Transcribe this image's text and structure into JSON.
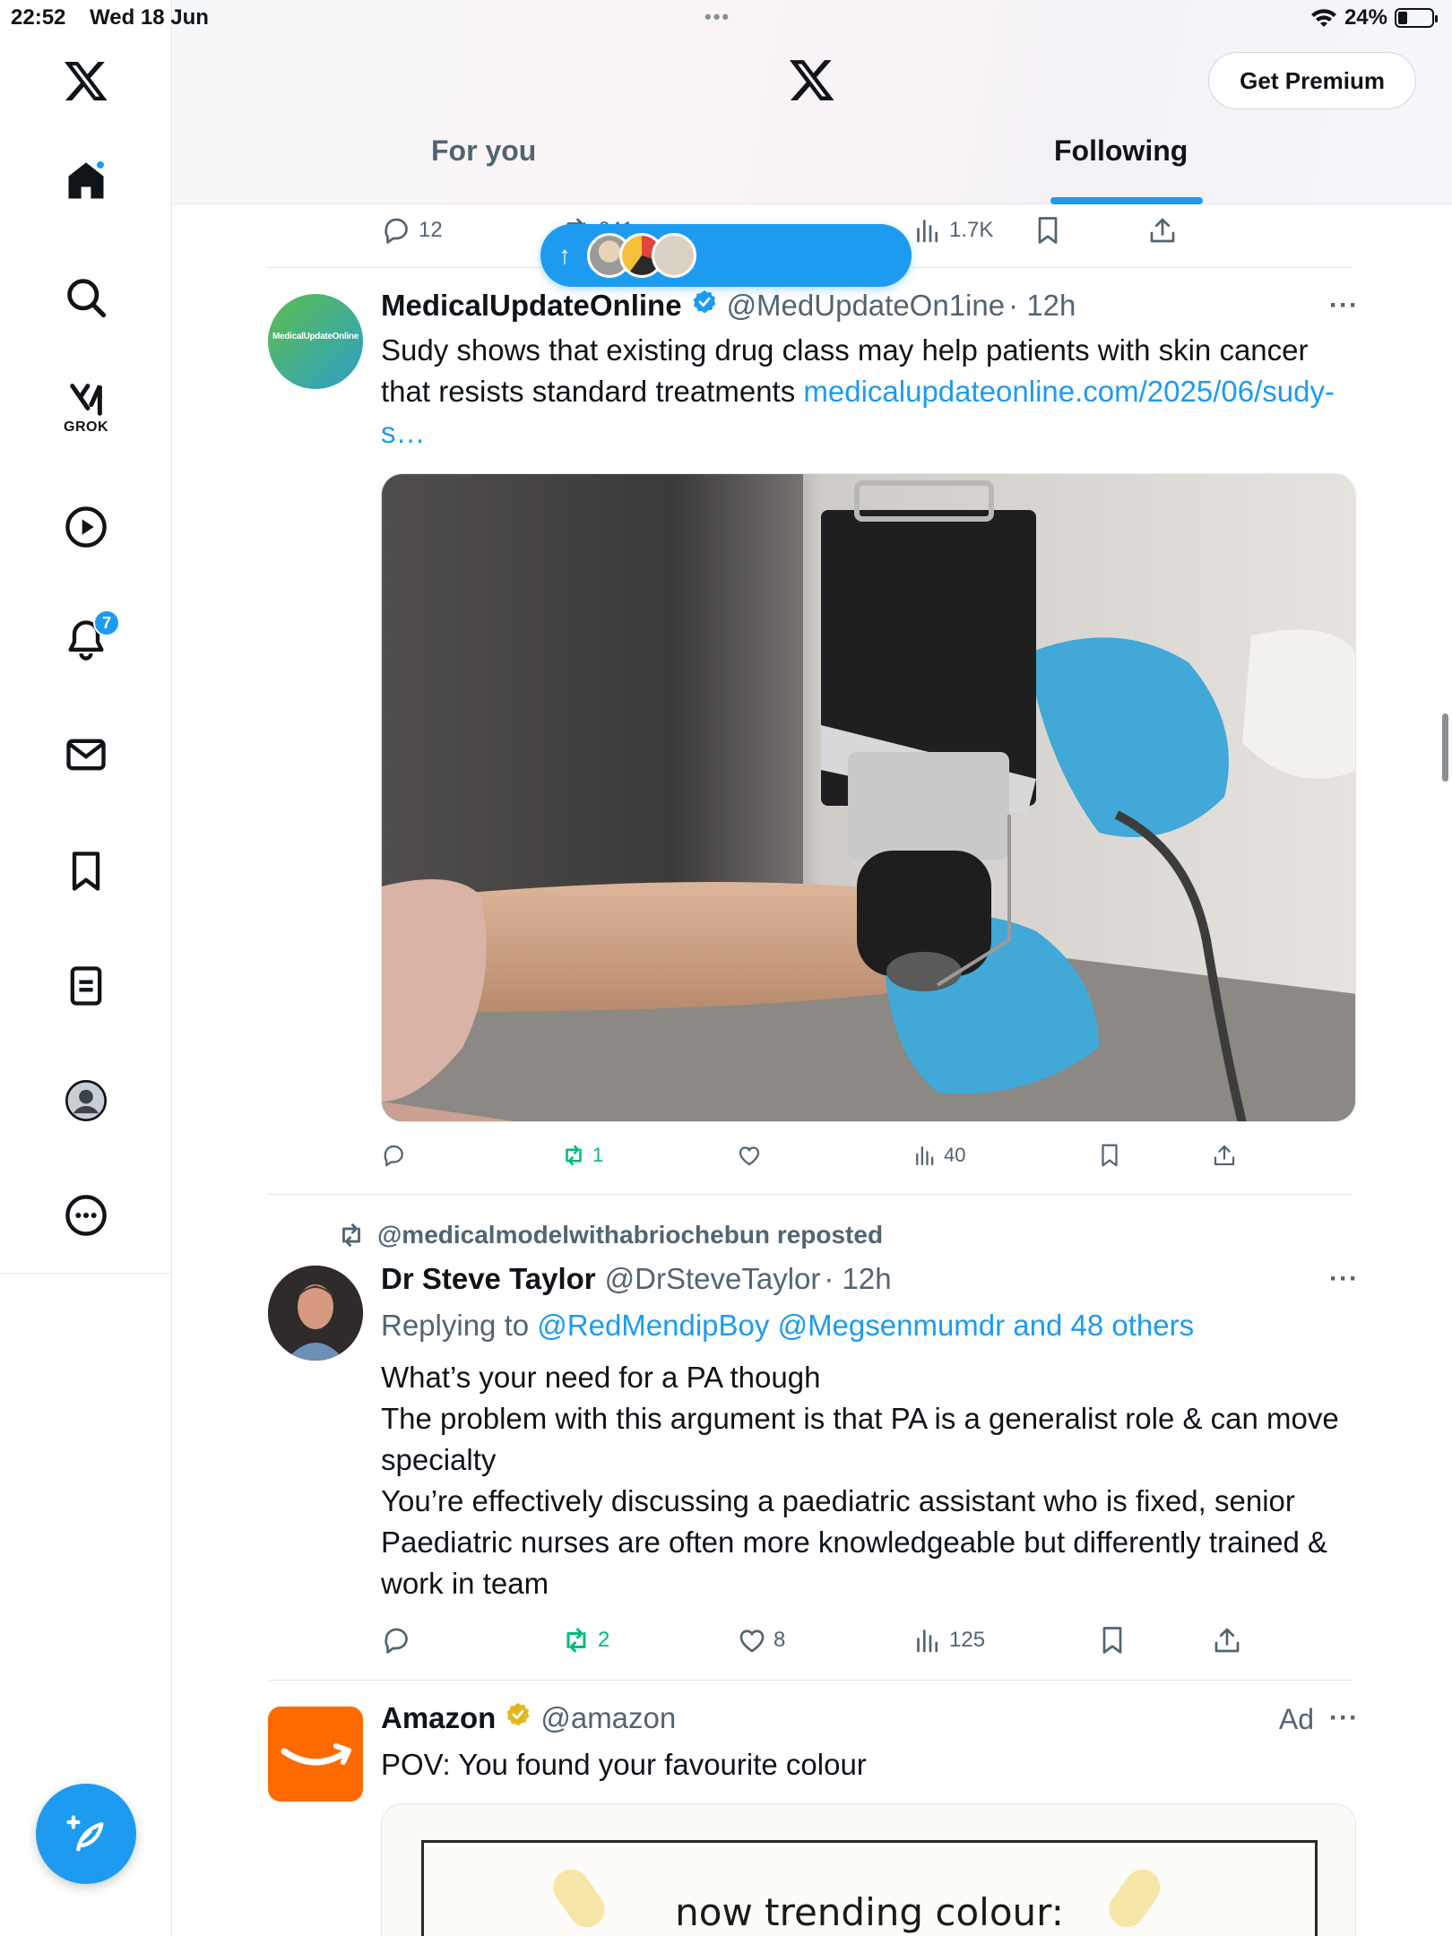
{
  "status_bar": {
    "time": "22:52",
    "date": "Wed 18 Jun",
    "battery": "24%",
    "dots": "•••"
  },
  "sidebar": {
    "items": [
      {
        "name": "x-logo"
      },
      {
        "name": "home",
        "has_dot": true
      },
      {
        "name": "search"
      },
      {
        "name": "grok",
        "label": "GROK"
      },
      {
        "name": "video"
      },
      {
        "name": "notifications",
        "badge": "7"
      },
      {
        "name": "messages"
      },
      {
        "name": "bookmarks"
      },
      {
        "name": "lists"
      },
      {
        "name": "profile"
      },
      {
        "name": "more"
      }
    ]
  },
  "header": {
    "premium_label": "Get Premium",
    "tabs": [
      {
        "label": "For you",
        "active": false
      },
      {
        "label": "Following",
        "active": true
      }
    ]
  },
  "prev_post": {
    "replies": "12",
    "reposts": "641",
    "views": "1.7K"
  },
  "new_posts_pill": {
    "arrow": "↑"
  },
  "post1": {
    "name": "MedicalUpdateOnline",
    "handle": "@MedUpdateOn1ine",
    "time": "· 12h",
    "avatar_text": "MedicalUpdateOnline",
    "text": "Sudy shows that existing drug class may help patients with skin cancer that resists standard treatments ",
    "link": "medicalupdateonline.com/2025/06/sudy-s…",
    "reposts": "1",
    "views": "40"
  },
  "post2": {
    "repost_by": "@medicalmodelwithabriochebun reposted",
    "name": "Dr Steve Taylor",
    "handle": "@DrSteveTaylor",
    "time": "· 12h",
    "replying_prefix": "Replying to ",
    "replying_to": "@RedMendipBoy @Megsenmumdr and 48 others",
    "lines": [
      "What’s your need for a PA though",
      "The problem with this argument is that PA is a generalist role & can move specialty",
      "You’re effectively discussing a paediatric assistant who is fixed, senior Paediatric nurses are often more knowledgeable but differently trained & work in team"
    ],
    "reposts": "2",
    "likes": "8",
    "views": "125"
  },
  "post3": {
    "name": "Amazon",
    "handle": "@amazon",
    "ad_label": "Ad",
    "text": "POV: You found your favourite colour",
    "card_text": "now trending colour:"
  },
  "colors": {
    "accent": "#1d9bf0",
    "repost_green": "#00ba7c",
    "muted": "#536471",
    "amazon_orange": "#ff6a00"
  }
}
